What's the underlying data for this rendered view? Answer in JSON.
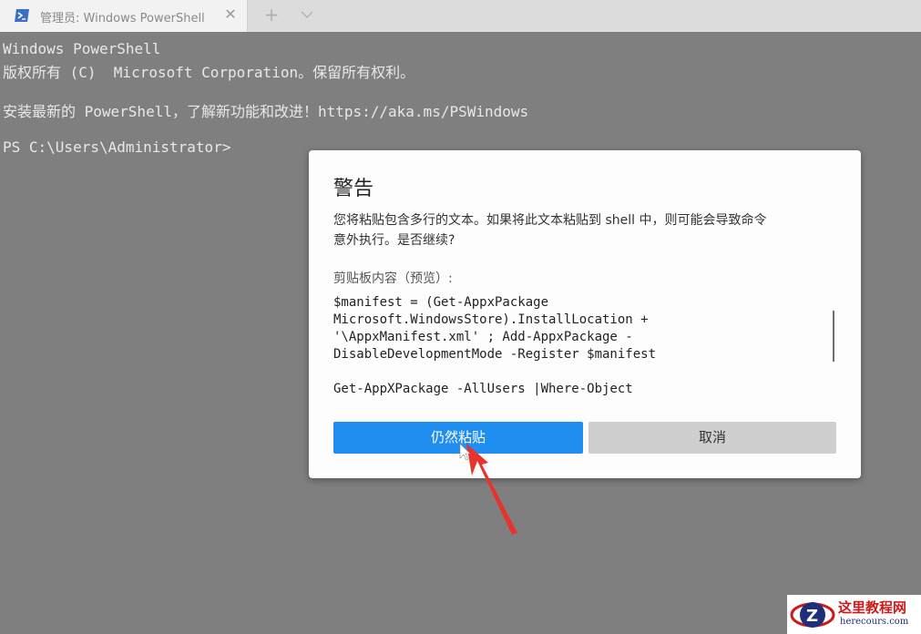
{
  "tab": {
    "title": "管理员: Windows PowerShell"
  },
  "terminal": {
    "lines": [
      "Windows PowerShell",
      "版权所有 (C)  Microsoft Corporation。保留所有权利。",
      "安装最新的 PowerShell，了解新功能和改进！https://aka.ms/PSWindows",
      "PS C:\\Users\\Administrator>"
    ]
  },
  "dialog": {
    "title": "警告",
    "message_line1": "您将粘贴包含多行的文本。如果将此文本粘贴到 shell 中，则可能会导致命令",
    "message_line2": "意外执行。是否继续?",
    "clipboard_label": "剪贴板内容（预览）:",
    "preview_lines": [
      "$manifest = (Get-AppxPackage",
      "Microsoft.WindowsStore).InstallLocation +",
      "'\\AppxManifest.xml' ; Add-AppxPackage -",
      "DisableDevelopmentMode -Register $manifest",
      "",
      "Get-AppXPackage -AllUsers |Where-Object"
    ],
    "paste_anyway_label": "仍然粘贴",
    "cancel_label": "取消"
  },
  "watermark": {
    "brand": "这里教程网",
    "url": "herecours.com"
  },
  "colors": {
    "accent": "#1f8ef0",
    "annotation_arrow": "#e8322e",
    "terminal_bg": "#7f7f7f"
  }
}
